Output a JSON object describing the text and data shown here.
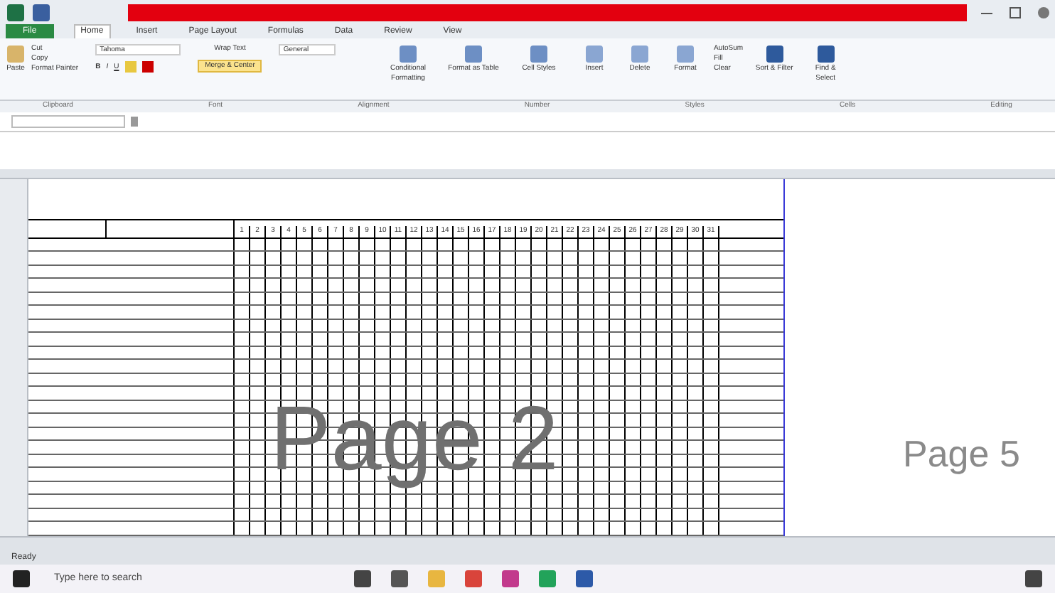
{
  "menu_tabs": [
    {
      "label": "File",
      "selected": false,
      "kind": "file"
    },
    {
      "label": "Home",
      "selected": true,
      "kind": "tab"
    },
    {
      "label": "Insert",
      "selected": false,
      "kind": "tab"
    },
    {
      "label": "Page Layout",
      "selected": false,
      "kind": "tab"
    },
    {
      "label": "Formulas",
      "selected": false,
      "kind": "tab"
    },
    {
      "label": "Data",
      "selected": false,
      "kind": "tab"
    },
    {
      "label": "Review",
      "selected": false,
      "kind": "tab"
    },
    {
      "label": "View",
      "selected": false,
      "kind": "tab"
    }
  ],
  "ribbon": {
    "font_name": "Tahoma",
    "number_format": "General",
    "groups": [
      "Clipboard",
      "Font",
      "Alignment",
      "Number",
      "Styles",
      "Cells",
      "Editing"
    ],
    "clipboard": [
      "Cut",
      "Copy",
      "Format Painter"
    ],
    "paste": "Paste",
    "font_buttons": [
      "B",
      "I",
      "U"
    ],
    "wrap_text": "Wrap Text",
    "merge": "Merge & Center",
    "styles": [
      "Conditional Formatting",
      "Format as Table",
      "Cell Styles"
    ],
    "cells": [
      "Insert",
      "Delete",
      "Format"
    ],
    "editing_small": [
      "AutoSum",
      "Fill",
      "Clear"
    ],
    "editing_big": [
      "Sort & Filter",
      "Find & Select"
    ]
  },
  "sheet": {
    "days": [
      "1",
      "2",
      "3",
      "4",
      "5",
      "6",
      "7",
      "8",
      "9",
      "10",
      "11",
      "12",
      "13",
      "14",
      "15",
      "16",
      "17",
      "18",
      "19",
      "20",
      "21",
      "22",
      "23",
      "24",
      "25",
      "26",
      "27",
      "28",
      "29",
      "30",
      "31"
    ],
    "page_labels": [
      "Page 2",
      "Page 5"
    ]
  },
  "status_bar": {
    "text": "Ready"
  },
  "taskbar": {
    "search_placeholder": "Type here to search"
  }
}
